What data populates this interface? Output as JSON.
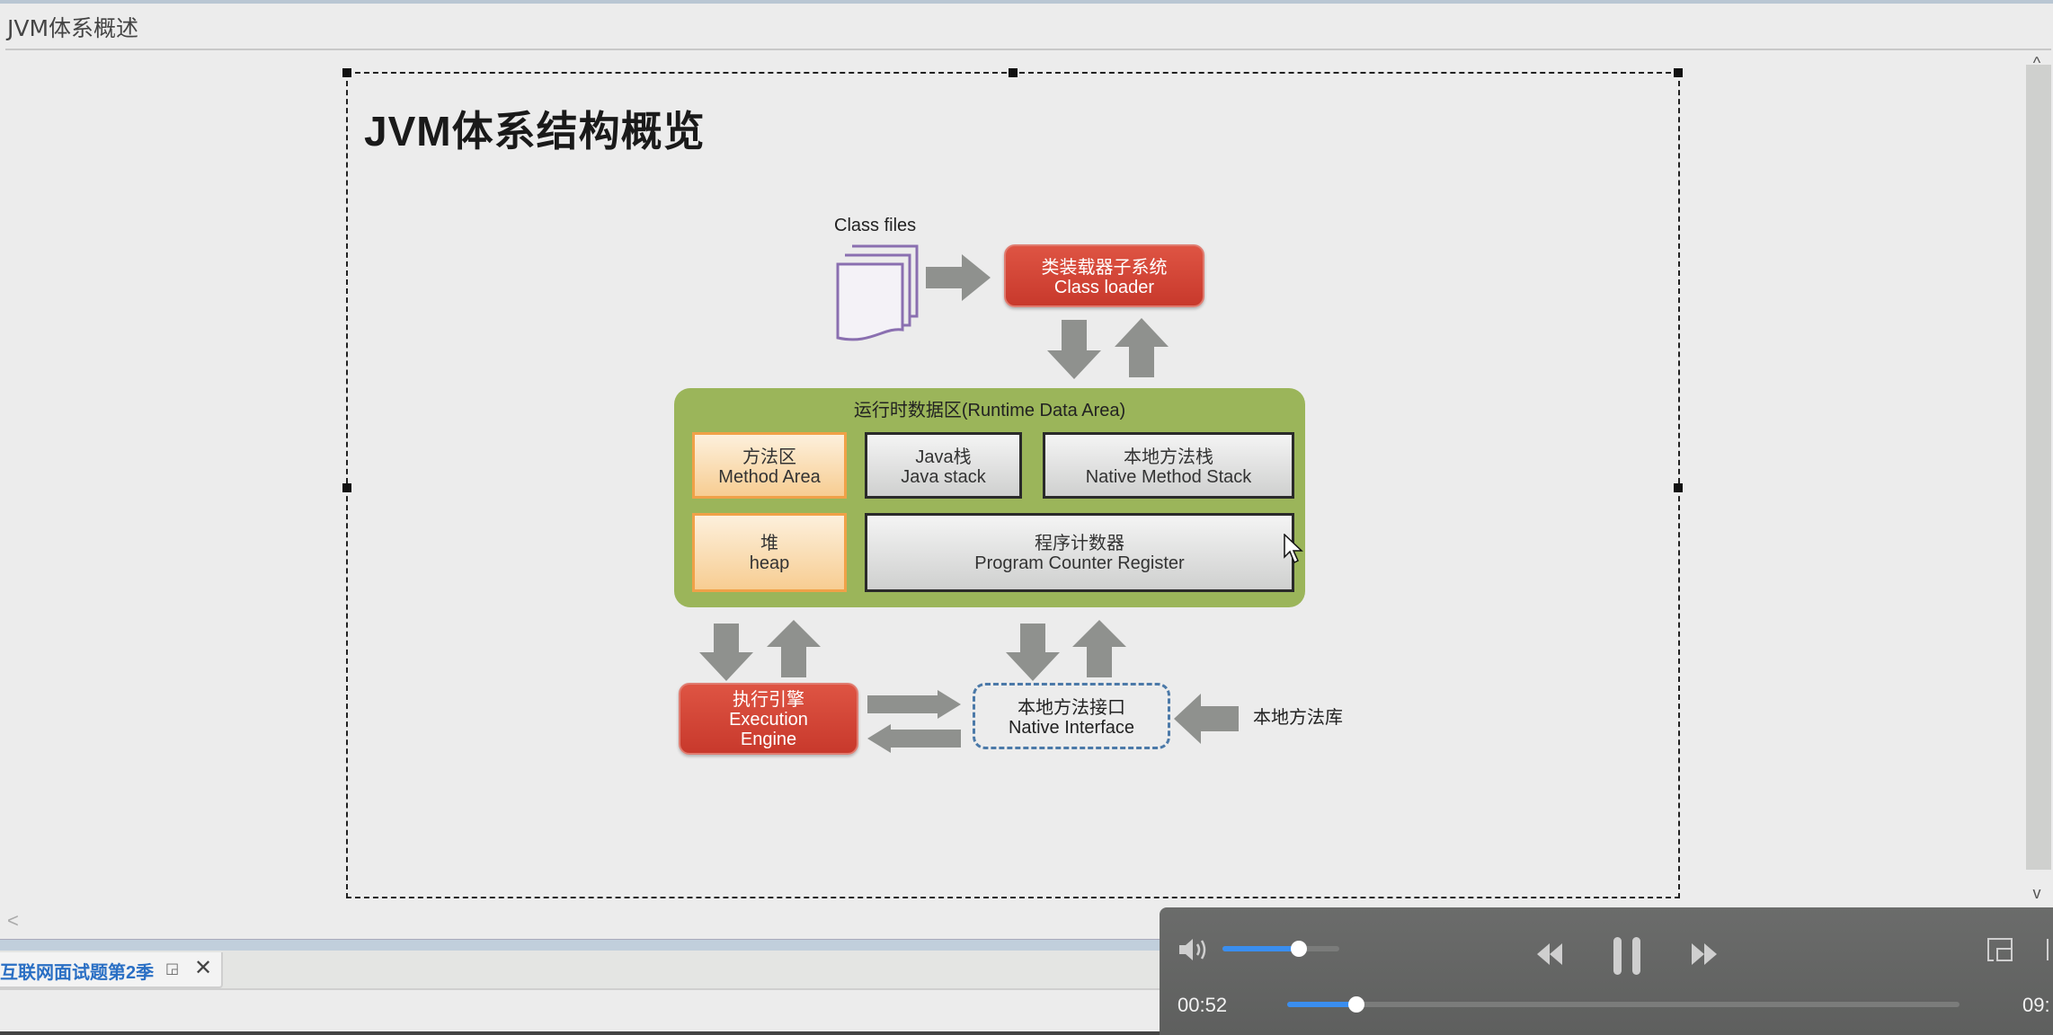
{
  "window": {
    "doc_title": "JVM体系概述"
  },
  "slide": {
    "title": "JVM体系结构概览",
    "diagram": {
      "class_files_label": "Class files",
      "class_loader": {
        "zh": "类装载器子系统",
        "en": "Class loader"
      },
      "runtime_area_title": "运行时数据区(Runtime Data Area)",
      "method_area": {
        "zh": "方法区",
        "en": "Method Area"
      },
      "java_stack": {
        "zh": "Java栈",
        "en": "Java stack"
      },
      "native_method_stack": {
        "zh": "本地方法栈",
        "en": "Native Method Stack"
      },
      "heap": {
        "zh": "堆",
        "en": "heap"
      },
      "pc_register": {
        "zh": "程序计数器",
        "en": "Program Counter Register"
      },
      "execution_engine": {
        "zh": "执行引擎",
        "en1": "Execution",
        "en2": "Engine"
      },
      "native_interface": {
        "zh": "本地方法接口",
        "en": "Native Interface"
      },
      "native_library": "本地方法库"
    },
    "colors": {
      "runtime_green": "#9bb55a",
      "engine_red": "#d44a3b",
      "memory_orange": "#f7cd92",
      "interface_blue": "#4b79a8",
      "arrow_gray": "#8f918e"
    }
  },
  "tabs": {
    "active_label": "互联网面试题第2季"
  },
  "icons": {
    "scroll_up": "^",
    "scroll_down": "v",
    "scroll_left": "<",
    "tab_restore": "◲",
    "tab_close": "✕"
  },
  "player": {
    "current_time": "00:52",
    "total_time": "09:",
    "volume_fraction": 0.65,
    "progress_fraction": 0.103,
    "state": "playing",
    "accent": "#3a8ef0"
  }
}
